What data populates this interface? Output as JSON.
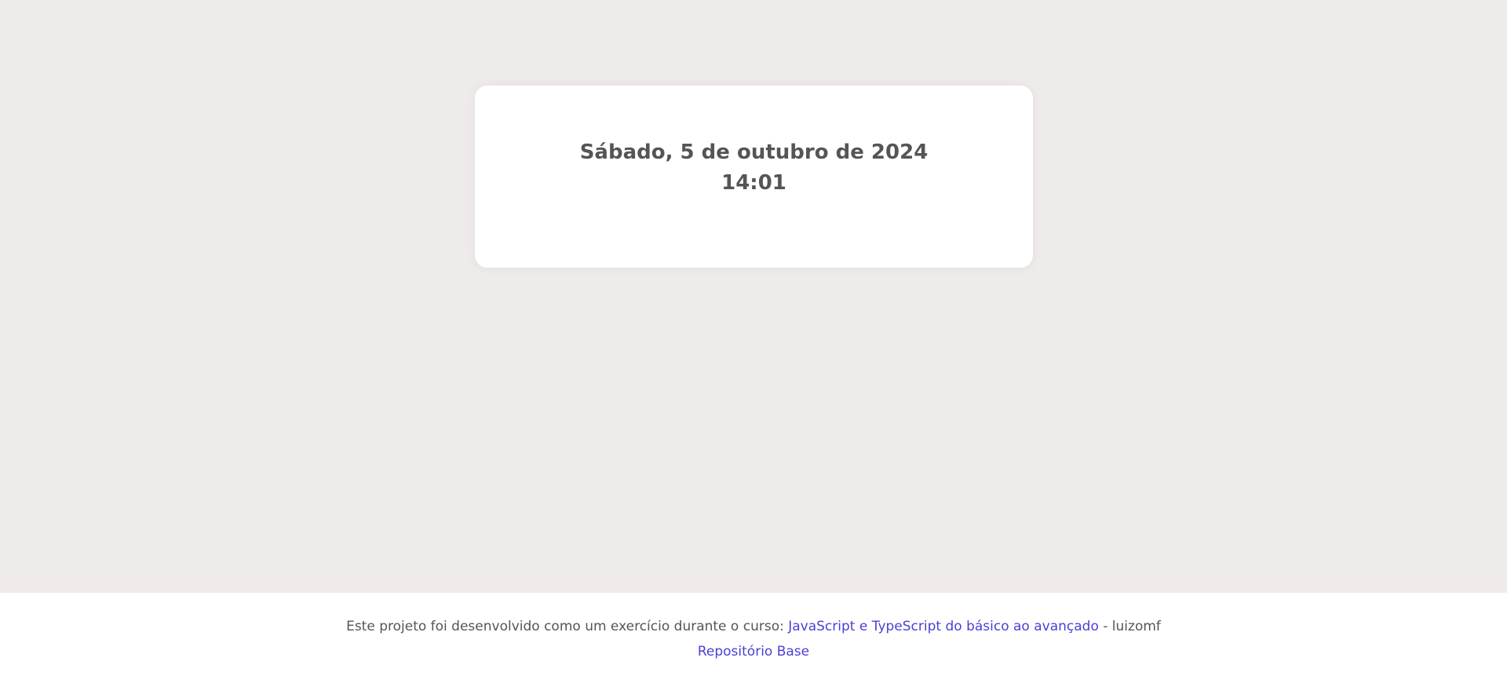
{
  "clock": {
    "date": "Sábado, 5 de outubro de 2024",
    "time": "14:01"
  },
  "footer": {
    "prefix": "Este projeto foi desenvolvido como um exercício durante o curso: ",
    "course_link": "JavaScript e TypeScript do básico ao avançado",
    "suffix": " - luizomf",
    "repo_link": "Repositório Base"
  },
  "colors": {
    "background": "#efebea",
    "card": "#ffffff",
    "text": "#555555",
    "link": "#4b3fd6"
  }
}
